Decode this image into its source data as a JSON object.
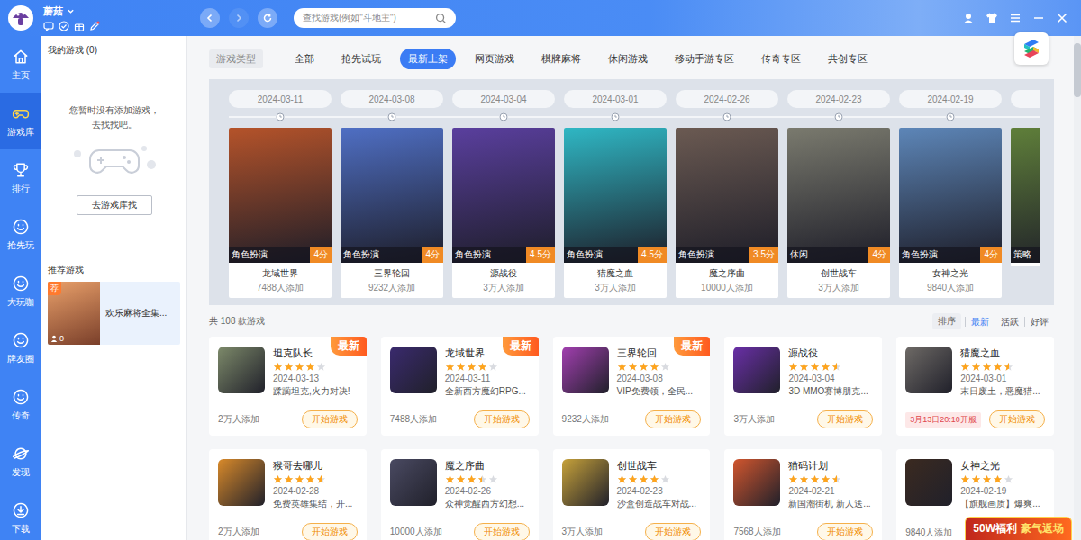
{
  "user": {
    "name": "蘑菇"
  },
  "nav": {
    "back_disabled": false,
    "forward_disabled": true
  },
  "search": {
    "placeholder": "查找游戏(例如\"斗地主\")"
  },
  "rail": [
    {
      "label": "主页",
      "selected": false
    },
    {
      "label": "游戏库",
      "selected": true
    },
    {
      "label": "排行",
      "selected": false
    },
    {
      "label": "抢先玩",
      "selected": false
    },
    {
      "label": "大玩咖",
      "selected": false
    },
    {
      "label": "牌友圈",
      "selected": false
    },
    {
      "label": "传奇",
      "selected": false
    },
    {
      "label": "发现",
      "selected": false
    },
    {
      "label": "下载",
      "selected": false
    }
  ],
  "my_games": {
    "title": "我的游戏 (0)",
    "empty_lines": [
      "您暂时没有添加游戏，",
      "去找找吧。"
    ],
    "button": "去游戏库找"
  },
  "recommended": {
    "title": "推荐游戏",
    "items": [
      {
        "badge": "荐",
        "name": "欢乐麻将全集...",
        "count": "0",
        "color": "#e9a06a"
      }
    ]
  },
  "categories": {
    "label": "游戏类型",
    "tabs": [
      {
        "label": "全部",
        "selected": false
      },
      {
        "label": "抢先试玩",
        "selected": false
      },
      {
        "label": "最新上架",
        "selected": true
      },
      {
        "label": "网页游戏",
        "selected": false
      },
      {
        "label": "棋牌麻将",
        "selected": false
      },
      {
        "label": "休闲游戏",
        "selected": false
      },
      {
        "label": "移动手游专区",
        "selected": false
      },
      {
        "label": "传奇专区",
        "selected": false
      },
      {
        "label": "共创专区",
        "selected": false
      }
    ]
  },
  "timeline": [
    {
      "date": "2024-03-11",
      "name": "龙域世界",
      "genre": "角色扮演",
      "score": "4分",
      "count": "7488人添加",
      "color": "#b5532a"
    },
    {
      "date": "2024-03-08",
      "name": "三界轮回",
      "genre": "角色扮演",
      "score": "4分",
      "count": "9232人添加",
      "color": "#4f6fc4"
    },
    {
      "date": "2024-03-04",
      "name": "源战役",
      "genre": "角色扮演",
      "score": "4.5分",
      "count": "3万人添加",
      "color": "#5a3f9e"
    },
    {
      "date": "2024-03-01",
      "name": "猎魔之血",
      "genre": "角色扮演",
      "score": "4.5分",
      "count": "3万人添加",
      "color": "#2fb7c4"
    },
    {
      "date": "2024-02-26",
      "name": "魔之序曲",
      "genre": "角色扮演",
      "score": "3.5分",
      "count": "10000人添加",
      "color": "#6b5a52"
    },
    {
      "date": "2024-02-23",
      "name": "创世战车",
      "genre": "休闲",
      "score": "4分",
      "count": "3万人添加",
      "color": "#7a7a6e"
    },
    {
      "date": "2024-02-19",
      "name": "女神之光",
      "genre": "角色扮演",
      "score": "4分",
      "count": "9840人添加",
      "color": "#5d86b8"
    },
    {
      "genre": "策略",
      "color": "#5f7f3a"
    }
  ],
  "total": "共 108 款游戏",
  "sort": {
    "label": "排序",
    "options": [
      {
        "label": "最新",
        "selected": true
      },
      {
        "label": "活跃",
        "selected": false
      },
      {
        "label": "好评",
        "selected": false
      }
    ]
  },
  "games": [
    {
      "name": "坦克队长",
      "date": "2024-03-13",
      "stars": 4,
      "desc": "蹂躏坦克,火力对决!",
      "count": "2万人添加",
      "button": "开始游戏",
      "badge": "最新",
      "color": "#7d8a6a"
    },
    {
      "name": "龙域世界",
      "date": "2024-03-11",
      "stars": 4,
      "desc": "全新西方魔幻RPG...",
      "count": "7488人添加",
      "button": "开始游戏",
      "badge": "最新",
      "color": "#3a2a6e"
    },
    {
      "name": "三界轮回",
      "date": "2024-03-08",
      "stars": 4,
      "desc": "VIP免费领，全民...",
      "count": "9232人添加",
      "button": "开始游戏",
      "badge": "最新",
      "color": "#a23fb0"
    },
    {
      "name": "源战役",
      "date": "2024-03-04",
      "stars": 4.5,
      "desc": "3D MMO赛博朋克...",
      "count": "3万人添加",
      "button": "开始游戏",
      "color": "#6a2fa8"
    },
    {
      "name": "猎魔之血",
      "date": "2024-03-01",
      "stars": 4.5,
      "desc": "末日废土，恶魔猎...",
      "notice": "3月13日20:10开服",
      "button": "开始游戏",
      "color": "#6e6a66"
    },
    {
      "name": "猴哥去哪儿",
      "date": "2024-02-28",
      "stars": 4.5,
      "desc": "免费英雄集结，开...",
      "count": "2万人添加",
      "button": "开始游戏",
      "color": "#d98a2a"
    },
    {
      "name": "魔之序曲",
      "date": "2024-02-26",
      "stars": 3.5,
      "desc": "众神觉醒西方幻想...",
      "count": "10000人添加",
      "button": "开始游戏",
      "color": "#4a4a62"
    },
    {
      "name": "创世战车",
      "date": "2024-02-23",
      "stars": 4,
      "desc": "沙盒创造战车对战...",
      "count": "3万人添加",
      "button": "开始游戏",
      "color": "#c7a23a"
    },
    {
      "name": "猫码计划",
      "date": "2024-02-21",
      "stars": 4.5,
      "desc": "新国潮街机 新人送...",
      "count": "7568人添加",
      "button": "开始游戏",
      "color": "#d2562e"
    },
    {
      "name": "女神之光",
      "date": "2024-02-19",
      "stars": 4,
      "desc": "【旗舰画质】爆爽...",
      "count": "9840人添加",
      "color": "#3b2a20"
    }
  ],
  "promo": {
    "highlight": "50W福利",
    "text": "豪气返场"
  }
}
